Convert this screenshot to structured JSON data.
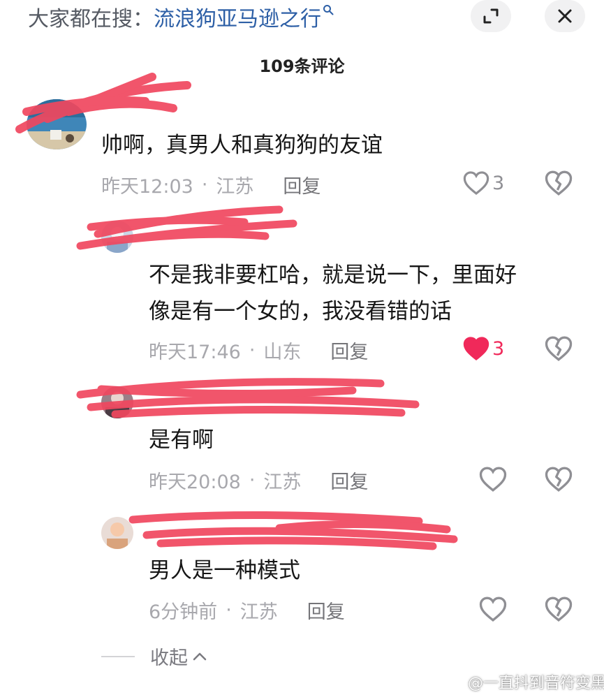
{
  "search": {
    "prefix": "大家都在搜：",
    "term": "流浪狗亚马逊之行",
    "icon": "search-icon"
  },
  "header": {
    "comment_count": "109条评论",
    "expand_icon": "expand-icon",
    "close_icon": "close-icon"
  },
  "comments": [
    {
      "text": "帅啊，真男人和真狗狗的友谊",
      "time": "昨天12:03",
      "location": "江苏",
      "reply": "回复",
      "likes": "3",
      "liked": false
    },
    {
      "text_line1": "不是我非要杠哈，就是说一下，里面好",
      "text_line2": "像是有一个女的，我没看错的话",
      "time": "昨天17:46",
      "location": "山东",
      "reply": "回复",
      "likes": "3",
      "liked": true
    },
    {
      "text": "是有啊",
      "time": "昨天20:08",
      "location": "江苏",
      "reply": "回复"
    },
    {
      "text": "男人是一种模式",
      "time": "6分钟前",
      "location": "江苏",
      "reply": "回复"
    }
  ],
  "meta_separator": "·",
  "collapse": {
    "label": "收起"
  },
  "watermark": {
    "text": "@一直抖到音符变黑"
  },
  "colors": {
    "liked_heart": "#f0295a",
    "scribble": "#f0475f",
    "search_term": "#2d5fa6"
  }
}
